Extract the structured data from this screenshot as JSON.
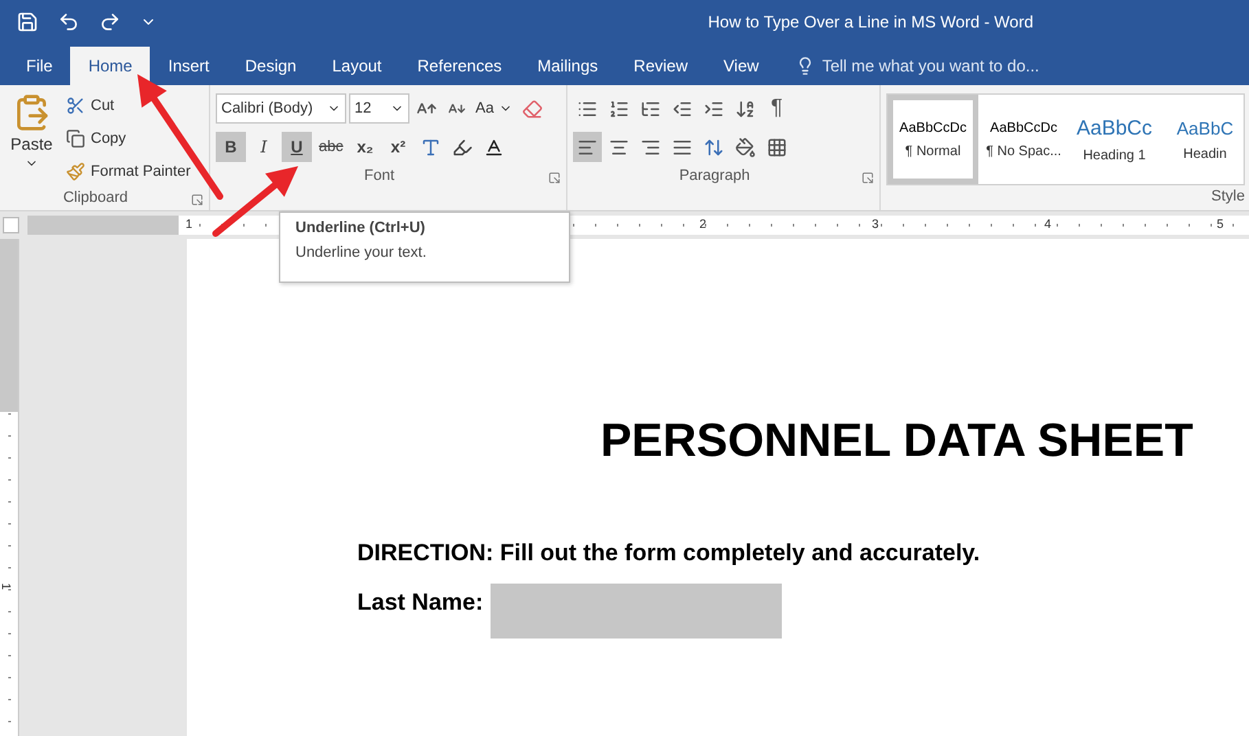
{
  "window": {
    "title": "How to Type Over a Line in MS Word - Word"
  },
  "tabs": [
    {
      "label": "File",
      "selected": false
    },
    {
      "label": "Home",
      "selected": true
    },
    {
      "label": "Insert",
      "selected": false
    },
    {
      "label": "Design",
      "selected": false
    },
    {
      "label": "Layout",
      "selected": false
    },
    {
      "label": "References",
      "selected": false
    },
    {
      "label": "Mailings",
      "selected": false
    },
    {
      "label": "Review",
      "selected": false
    },
    {
      "label": "View",
      "selected": false
    }
  ],
  "tell_me": {
    "placeholder": "Tell me what you want to do..."
  },
  "clipboard": {
    "paste": "Paste",
    "cut": "Cut",
    "copy": "Copy",
    "format_painter": "Format Painter",
    "label": "Clipboard"
  },
  "font": {
    "name": "Calibri (Body)",
    "size": "12",
    "change_case": "Aa",
    "label": "Font",
    "buttons": [
      {
        "kind": "bold",
        "label": "B",
        "selected": true
      },
      {
        "kind": "italic",
        "label": "I",
        "selected": false
      },
      {
        "kind": "underline",
        "label": "U",
        "selected": true
      },
      {
        "kind": "strike",
        "label": "abc",
        "selected": false
      },
      {
        "kind": "sub",
        "label": "x₂",
        "selected": false
      },
      {
        "kind": "sup",
        "label": "x²",
        "selected": false
      }
    ]
  },
  "paragraph": {
    "label": "Paragraph",
    "pilcrow": "¶",
    "alignments": [
      {
        "kind": "left",
        "selected": true
      },
      {
        "kind": "center",
        "selected": false
      },
      {
        "kind": "right",
        "selected": false
      },
      {
        "kind": "justify",
        "selected": false
      }
    ]
  },
  "styles": {
    "label": "Style",
    "items": [
      {
        "preview": "AaBbCcDc",
        "name": "¶ Normal",
        "kind": "body",
        "selected": true
      },
      {
        "preview": "AaBbCcDc",
        "name": "¶ No Spac...",
        "kind": "body",
        "selected": false
      },
      {
        "preview": "AaBbCc",
        "name": "Heading 1",
        "kind": "heading",
        "selected": false
      },
      {
        "preview": "AaBbC",
        "name": "Headin",
        "kind": "heading2",
        "selected": false
      }
    ]
  },
  "tooltip": {
    "title": "Underline (Ctrl+U)",
    "text": "Underline your text."
  },
  "ruler": {
    "numbers": [
      "1",
      "2",
      "3",
      "4",
      "5"
    ],
    "vertical_number": "1"
  },
  "document": {
    "title": "PERSONNEL DATA SHEET",
    "direction": "DIRECTION: Fill out the form completely and accurately.",
    "field_label": "Last Name:"
  }
}
